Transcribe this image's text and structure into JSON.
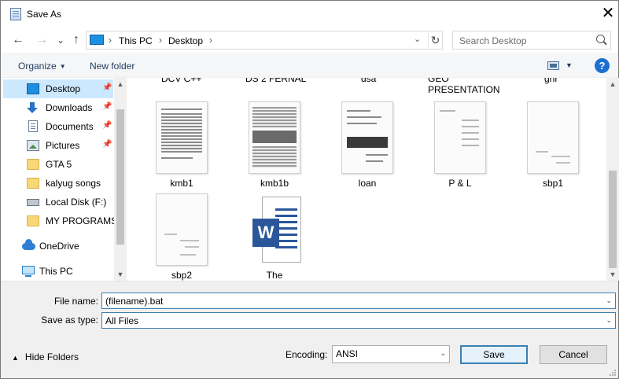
{
  "window": {
    "title": "Save As",
    "close_label": "✕"
  },
  "navigation": {
    "back": "←",
    "forward": "→",
    "recent": "⌄",
    "up": "↑",
    "breadcrumb": [
      "This PC",
      "Desktop"
    ],
    "refresh": "↻",
    "search_placeholder": "Search Desktop"
  },
  "toolbar": {
    "organize": "Organize",
    "new_folder": "New folder",
    "help": "?"
  },
  "sidebar": {
    "items": [
      {
        "label": "Desktop",
        "icon": "desktop-icon",
        "pinned": true
      },
      {
        "label": "Downloads",
        "icon": "download-icon",
        "pinned": true
      },
      {
        "label": "Documents",
        "icon": "documents-icon",
        "pinned": true
      },
      {
        "label": "Pictures",
        "icon": "pictures-icon",
        "pinned": true
      },
      {
        "label": "GTA 5",
        "icon": "folder-icon"
      },
      {
        "label": "kalyug songs",
        "icon": "folder-icon"
      },
      {
        "label": "Local Disk (F:)",
        "icon": "disk-icon"
      },
      {
        "label": "MY PROGRAMS",
        "icon": "folder-icon"
      },
      {
        "label": "OneDrive",
        "icon": "onedrive-icon"
      },
      {
        "label": "This PC",
        "icon": "computer-icon"
      }
    ]
  },
  "files": {
    "partial_row": [
      "DCV C++",
      "DS 2 FERNAL",
      "dsa",
      "GEO PRESENTATION",
      "gnr"
    ],
    "items": [
      {
        "label": "kmb1",
        "icon": "document-thumbnail"
      },
      {
        "label": "kmb1b",
        "icon": "document-thumbnail"
      },
      {
        "label": "loan",
        "icon": "document-thumbnail"
      },
      {
        "label": "P & L",
        "icon": "document-thumbnail"
      },
      {
        "label": "sbp1",
        "icon": "document-thumbnail"
      },
      {
        "label": "sbp2",
        "icon": "document-thumbnail"
      },
      {
        "label": "The",
        "icon": "word-document-icon"
      }
    ]
  },
  "form": {
    "file_name_label": "File name:",
    "file_name_value": "(filename).bat",
    "save_type_label": "Save as type:",
    "save_type_value": "All Files",
    "encoding_label": "Encoding:",
    "encoding_value": "ANSI",
    "hide_folders": "Hide Folders",
    "save_button": "Save",
    "cancel_button": "Cancel"
  },
  "colors": {
    "selection": "#cce8ff",
    "accent": "#3c7fb1",
    "word_blue": "#2b579a"
  }
}
